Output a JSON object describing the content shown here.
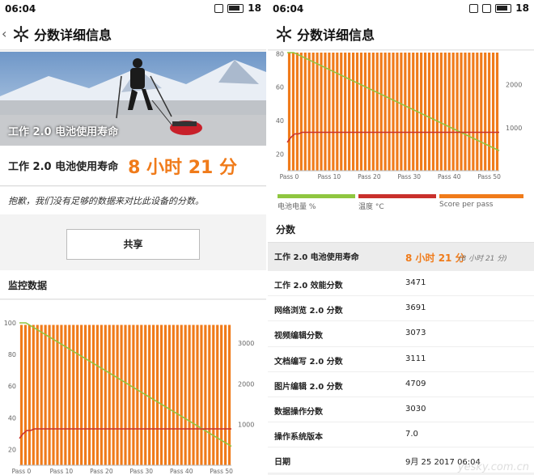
{
  "status": {
    "time": "06:04",
    "battery": "18"
  },
  "appbar": {
    "title": "分数详细信息"
  },
  "left": {
    "hero_caption": "工作 2.0 电池使用寿命",
    "life_label": "工作 2.0 电池使用寿命",
    "life_value": "8 小时 21 分",
    "note": "抱歉，我们没有足够的数据来对比此设备的分数。",
    "share_label": "共享",
    "section_title": "监控数据"
  },
  "right": {
    "legend": [
      "电池电量 %",
      "温度 °C",
      "Score per pass"
    ],
    "scores_title": "分数",
    "scores": [
      {
        "label": "工作 2.0 电池使用寿命",
        "value": "8 小时 21 分",
        "extra": "(8 小时 21 分)"
      },
      {
        "label": "工作 2.0 效能分数",
        "value": "3471"
      },
      {
        "label": "网络浏览 2.0 分数",
        "value": "3691"
      },
      {
        "label": "视频编辑分数",
        "value": "3073"
      },
      {
        "label": "文档编写 2.0 分数",
        "value": "3111"
      },
      {
        "label": "图片编辑 2.0 分数",
        "value": "4709"
      },
      {
        "label": "数据操作分数",
        "value": "3030"
      },
      {
        "label": "操作系统版本",
        "value": "7.0"
      },
      {
        "label": "日期",
        "value": "9月 25 2017 06:04"
      }
    ],
    "watermark": "yesky.com.cn"
  },
  "colors": {
    "accent": "#f07b1a",
    "battery_line": "#8fc640",
    "temp_line": "#c9302c"
  },
  "chart_data": {
    "type": "bar",
    "x_ticks": [
      "Pass 0",
      "Pass 10",
      "Pass 20",
      "Pass 30",
      "Pass 40",
      "Pass 50"
    ],
    "passes": 53,
    "left_axis_ticks": [
      "20",
      "40",
      "60",
      "80",
      "100"
    ],
    "right_axis_ticks": [
      "1000",
      "2000",
      "3000"
    ],
    "ylim_left": [
      10,
      100
    ],
    "ylim_right": [
      0,
      3500
    ],
    "series": [
      {
        "name": "电池电量 %",
        "type": "line",
        "start": 100,
        "end": 22
      },
      {
        "name": "温度 °C",
        "type": "line",
        "values": [
          27,
          30,
          32,
          32,
          33,
          33,
          33,
          33,
          33,
          33,
          33
        ]
      },
      {
        "name": "Score per pass",
        "type": "bar",
        "value": 3450
      }
    ]
  }
}
